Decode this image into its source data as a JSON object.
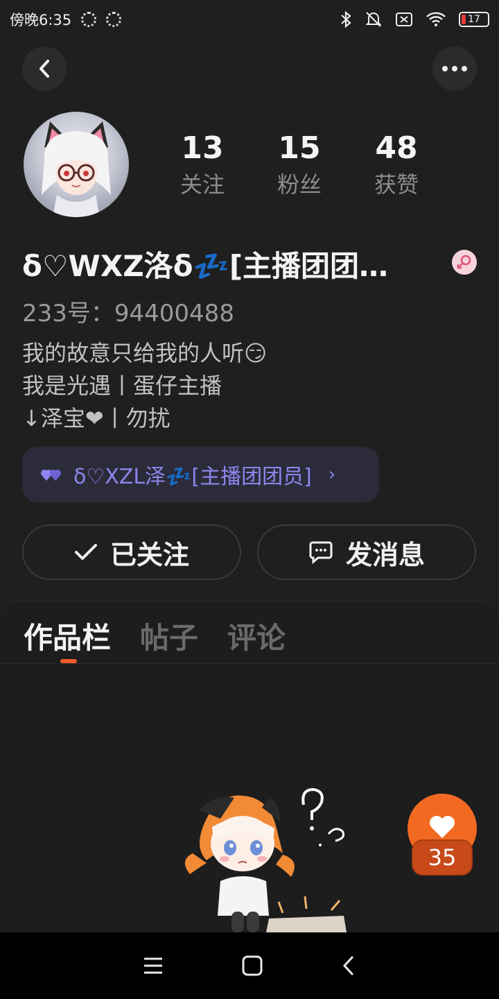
{
  "status_bar": {
    "time": "傍晚6:35",
    "battery": "17"
  },
  "profile": {
    "stats": [
      {
        "value": "13",
        "label": "关注"
      },
      {
        "value": "15",
        "label": "粉丝"
      },
      {
        "value": "48",
        "label": "获赞"
      }
    ],
    "nickname": "δ♡WXZ洛δ💤[主播团团…",
    "uid": "233号：94400488",
    "bio": [
      "我的故意只给我的人听😏",
      "我是光遇丨蛋仔主播",
      "↓泽宝❤丨勿扰"
    ],
    "linked_tag": "δ♡XZL泽💤[主播团团员]"
  },
  "actions": {
    "follow_label": "已关注",
    "message_label": "发消息"
  },
  "tabs": [
    {
      "label": "作品栏",
      "active": true
    },
    {
      "label": "帖子",
      "active": false
    },
    {
      "label": "评论",
      "active": false
    }
  ],
  "like_fab": {
    "count": "35"
  },
  "colors": {
    "background": "#1f1f1f",
    "accent": "#f26a22",
    "tag_text": "#8e85ee"
  }
}
